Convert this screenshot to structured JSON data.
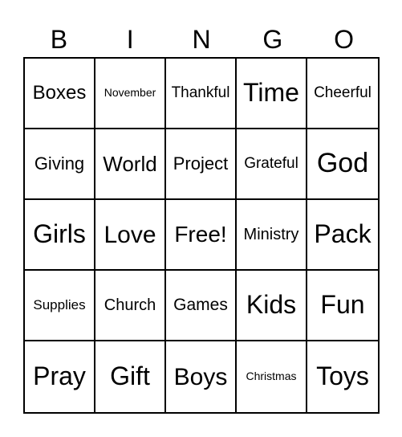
{
  "header": {
    "letters": [
      "B",
      "I",
      "N",
      "G",
      "O"
    ]
  },
  "board": {
    "rows": [
      [
        "Boxes",
        "November",
        "Thankful",
        "Time",
        "Cheerful"
      ],
      [
        "Giving",
        "World",
        "Project",
        "Grateful",
        "God"
      ],
      [
        "Girls",
        "Love",
        "Free!",
        "Ministry",
        "Pack"
      ],
      [
        "Supplies",
        "Church",
        "Games",
        "Kids",
        "Fun"
      ],
      [
        "Pray",
        "Gift",
        "Boys",
        "Christmas",
        "Toys"
      ]
    ]
  },
  "colors": {
    "background": "#ffffff",
    "grid_line": "#000000",
    "text": "#000000"
  }
}
